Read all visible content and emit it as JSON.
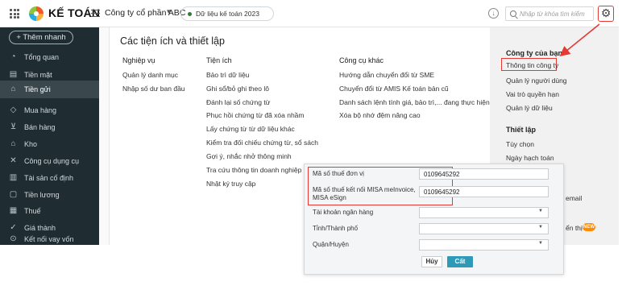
{
  "topbar": {
    "app_name": "KẾ TOÁN",
    "company": "Công ty cổ phần ABC",
    "data_label": "Dữ liệu kế toán 2023",
    "search_placeholder": "Nhập từ khóa tìm kiếm"
  },
  "sidebar": {
    "new_button": "+ Thêm nhanh",
    "items": [
      {
        "label": "Tổng quan",
        "icon": "pie-chart-icon"
      },
      {
        "label": "Tiền mặt",
        "icon": "cash-icon"
      },
      {
        "label": "Tiền gửi",
        "icon": "bank-icon"
      },
      {
        "label": "Mua hàng",
        "icon": "bag-icon"
      },
      {
        "label": "Bán hàng",
        "icon": "cart-icon"
      },
      {
        "label": "Kho",
        "icon": "warehouse-icon"
      },
      {
        "label": "Công cụ dụng cụ",
        "icon": "tools-icon"
      },
      {
        "label": "Tài sản cố định",
        "icon": "asset-icon"
      },
      {
        "label": "Tiền lương",
        "icon": "salary-icon"
      },
      {
        "label": "Thuế",
        "icon": "tax-icon"
      },
      {
        "label": "Giá thành",
        "icon": "price-icon"
      },
      {
        "label": "Kết nối vay vốn",
        "icon": "link-icon"
      }
    ]
  },
  "panel": {
    "title": "Các tiện ích và thiết lập",
    "col1": {
      "heading": "Nghiệp vụ",
      "items": [
        "Quản lý danh mục",
        "Nhập số dư ban đầu"
      ]
    },
    "col2": {
      "heading": "Tiện ích",
      "items": [
        "Bảo trì dữ liệu",
        "Ghi sổ/bỏ ghi theo lô",
        "Đánh lại số chứng từ",
        "Phục hồi chứng từ đã xóa nhầm",
        "Lấy chứng từ từ dữ liệu khác",
        "Kiểm tra đối chiếu chứng từ, sổ sách",
        "Gợi ý, nhắc nhở thông minh",
        "Tra cứu thông tin doanh nghiệp",
        "Nhật ký truy cập"
      ]
    },
    "col3": {
      "heading": "Công cụ khác",
      "items": [
        "Hướng dẫn chuyển đổi từ SME",
        "Chuyển đổi từ AMIS Kế toán bản cũ",
        "Danh sách lệnh tính giá, bảo trì,... đang thực hiện",
        "Xóa bộ nhớ đệm nâng cao"
      ]
    }
  },
  "right_panel": {
    "company_heading": "Công ty của bạn",
    "company_items": [
      "Thông tin công ty",
      "Quản lý người dùng",
      "Vai trò quyền hạn",
      "Quản lý dữ liệu"
    ],
    "setup_heading": "Thiết lập",
    "setup_items": [
      "Tùy chọn",
      "Ngày hạch toán"
    ],
    "email_partial": "email",
    "display_partial": "ển thị",
    "new_badge": "NEW"
  },
  "popup": {
    "rows": [
      {
        "label": "Mã số thuế đơn vị",
        "value": "0109645292",
        "type": "text"
      },
      {
        "label": "Mã số thuế kết nối MISA meInvoice, MISA eSign",
        "value": "0109645292",
        "type": "text"
      },
      {
        "label": "Tài khoản ngân hàng",
        "value": "",
        "type": "select"
      },
      {
        "label": "Tỉnh/Thành phố",
        "value": "",
        "type": "select"
      },
      {
        "label": "Quận/Huyện",
        "value": "",
        "type": "select"
      }
    ],
    "cancel_label": "Hủy",
    "save_label": "Cất"
  },
  "colors": {
    "sidebar_bg": "#1f2c32",
    "highlight_red": "#e53935",
    "save_button": "#2f9ab8"
  }
}
